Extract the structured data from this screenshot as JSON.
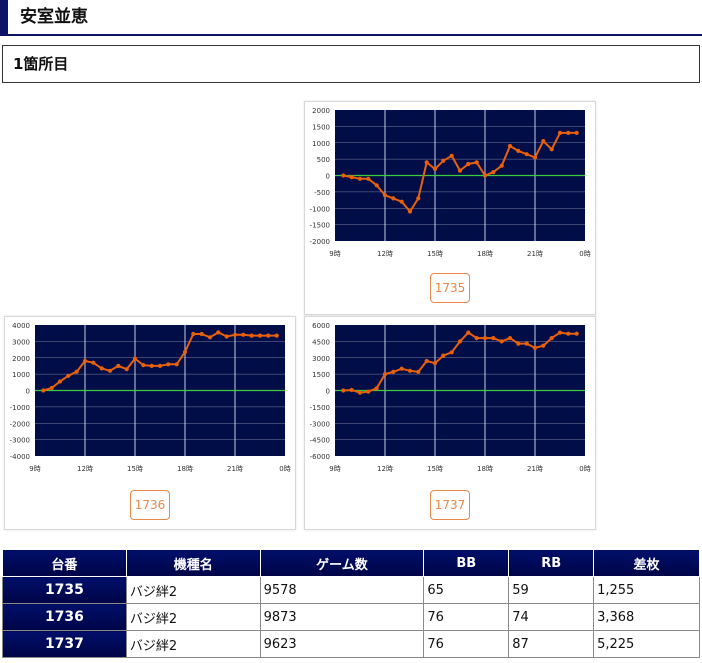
{
  "page": {
    "title": "安室並恵"
  },
  "section": {
    "title": "1箇所目"
  },
  "colors": {
    "plot_bg": "#000d47",
    "line": "#e8600c",
    "zero_line": "#3fc93f",
    "grid": "#7a7f9a",
    "accent": "#e8884a",
    "header_bg": "#000a5a"
  },
  "chart_data": [
    {
      "type": "line",
      "machine": "1735",
      "x_ticks": [
        "9時",
        "12時",
        "15時",
        "18時",
        "21時",
        "0時"
      ],
      "ylim": [
        -2000,
        2000
      ],
      "y_ticks": [
        "2000",
        "1500",
        "1000",
        "500",
        "0",
        "-500",
        "-1000",
        "-1500",
        "-2000"
      ],
      "series": [
        {
          "values": [
            0,
            -50,
            -100,
            -100,
            -300,
            -600,
            -700,
            -800,
            -1100,
            -700,
            400,
            200,
            450,
            600,
            150,
            350,
            400,
            0,
            100,
            300,
            900,
            750,
            650,
            550,
            1050,
            800,
            1300,
            1300,
            1300
          ]
        }
      ]
    },
    {
      "type": "line",
      "machine": "1736",
      "x_ticks": [
        "9時",
        "12時",
        "15時",
        "18時",
        "21時",
        "0時"
      ],
      "ylim": [
        -4000,
        4000
      ],
      "y_ticks": [
        "4000",
        "3000",
        "2000",
        "1000",
        "0",
        "-1000",
        "-2000",
        "-3000",
        "-4000"
      ],
      "series": [
        {
          "values": [
            0,
            150,
            550,
            900,
            1150,
            1800,
            1700,
            1350,
            1200,
            1500,
            1300,
            1950,
            1550,
            1500,
            1500,
            1600,
            1600,
            2350,
            3450,
            3450,
            3250,
            3550,
            3300,
            3400,
            3400,
            3350,
            3350,
            3350,
            3350
          ]
        }
      ]
    },
    {
      "type": "line",
      "machine": "1737",
      "x_ticks": [
        "9時",
        "12時",
        "15時",
        "18時",
        "21時",
        "0時"
      ],
      "ylim": [
        -6000,
        6000
      ],
      "y_ticks": [
        "6000",
        "4500",
        "3000",
        "1500",
        "0",
        "-1500",
        "-3000",
        "-4500",
        "-6000"
      ],
      "series": [
        {
          "values": [
            0,
            50,
            -200,
            -100,
            200,
            1500,
            1700,
            2000,
            1800,
            1700,
            2700,
            2500,
            3200,
            3500,
            4500,
            5300,
            4800,
            4800,
            4800,
            4500,
            4800,
            4300,
            4300,
            3900,
            4100,
            4800,
            5300,
            5200,
            5200
          ]
        }
      ]
    }
  ],
  "table": {
    "headers": [
      "台番",
      "機種名",
      "ゲーム数",
      "BB",
      "RB",
      "差枚"
    ],
    "rows": [
      [
        "1735",
        "バジ絆2",
        "9578",
        "65",
        "59",
        "1,255"
      ],
      [
        "1736",
        "バジ絆2",
        "9873",
        "76",
        "74",
        "3,368"
      ],
      [
        "1737",
        "バジ絆2",
        "9623",
        "76",
        "87",
        "5,225"
      ]
    ]
  }
}
